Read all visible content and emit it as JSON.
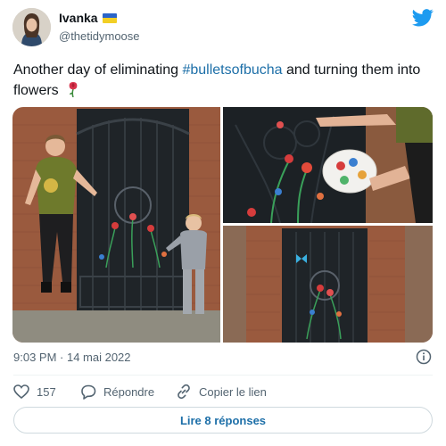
{
  "tweet": {
    "author_name": "Ivanka",
    "author_handle": "@thetidymoose",
    "text_before": "Another day of eliminating ",
    "hashtag": "#bulletsofbucha",
    "text_after": " and turning them into flowers",
    "timestamp": "9:03 PM · 14 mai 2022"
  },
  "actions": {
    "like_count": "157",
    "reply_label": "Répondre",
    "copy_link_label": "Copier le lien",
    "read_replies_label": "Lire 8 réponses"
  },
  "icons": {
    "brand": "twitter-bird-icon",
    "flag": "ukraine-flag-icon",
    "emoji": "rose-emoji-icon",
    "info": "info-icon",
    "like": "heart-icon",
    "reply": "speech-bubble-icon",
    "copy": "link-icon"
  },
  "colors": {
    "accent": "#1d9bf0",
    "link": "#1d6fa8",
    "muted": "#536471"
  }
}
